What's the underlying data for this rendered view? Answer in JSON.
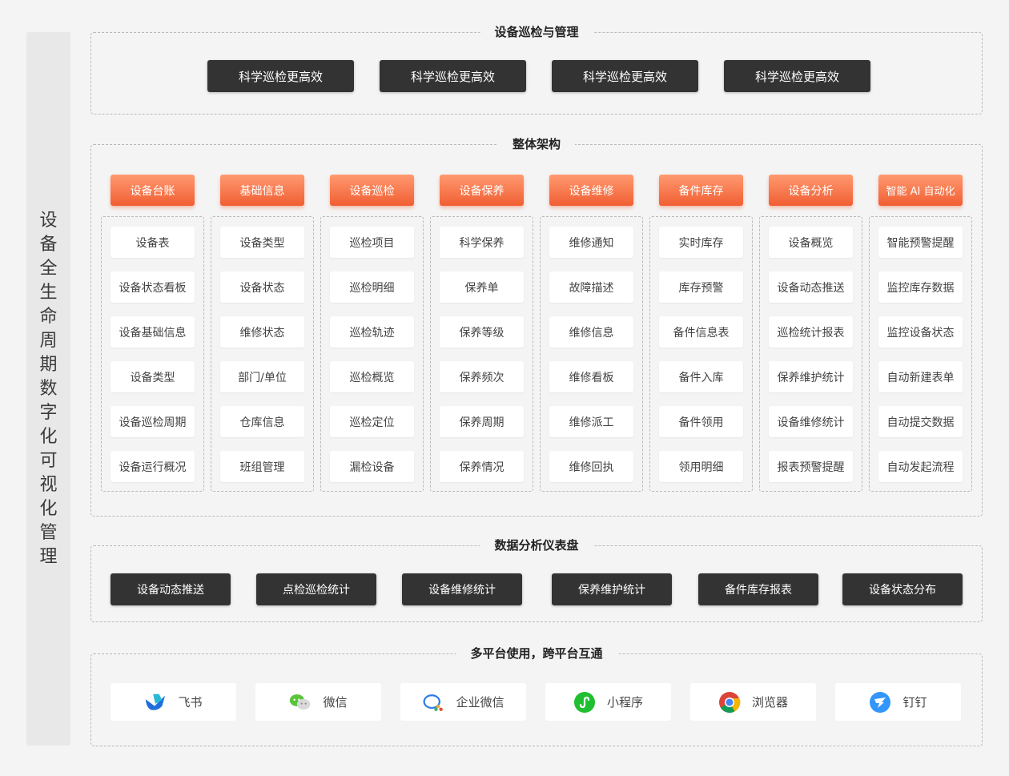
{
  "side_banner": {
    "title": "设备全生命周期数字化可视化管理"
  },
  "inspection": {
    "title": "设备巡检与管理",
    "buttons": [
      "科学巡检更高效",
      "科学巡检更高效",
      "科学巡检更高效",
      "科学巡检更高效"
    ]
  },
  "architecture": {
    "title": "整体架构",
    "columns": [
      {
        "header": "设备台账",
        "items": [
          "设备表",
          "设备状态看板",
          "设备基础信息",
          "设备类型",
          "设备巡检周期",
          "设备运行概况"
        ]
      },
      {
        "header": "基础信息",
        "items": [
          "设备类型",
          "设备状态",
          "维修状态",
          "部门/单位",
          "仓库信息",
          "班组管理"
        ]
      },
      {
        "header": "设备巡检",
        "items": [
          "巡检项目",
          "巡检明细",
          "巡检轨迹",
          "巡检概览",
          "巡检定位",
          "漏检设备"
        ]
      },
      {
        "header": "设备保养",
        "items": [
          "科学保养",
          "保养单",
          "保养等级",
          "保养频次",
          "保养周期",
          "保养情况"
        ]
      },
      {
        "header": "设备维修",
        "items": [
          "维修通知",
          "故障描述",
          "维修信息",
          "维修看板",
          "维修派工",
          "维修回执"
        ]
      },
      {
        "header": "备件库存",
        "items": [
          "实时库存",
          "库存预警",
          "备件信息表",
          "备件入库",
          "备件领用",
          "领用明细"
        ]
      },
      {
        "header": "设备分析",
        "items": [
          "设备概览",
          "设备动态推送",
          "巡检统计报表",
          "保养维护统计",
          "设备维修统计",
          "报表预警提醒"
        ]
      },
      {
        "header": "智能 AI 自动化",
        "items": [
          "智能预警提醒",
          "监控库存数据",
          "监控设备状态",
          "自动新建表单",
          "自动提交数据",
          "自动发起流程"
        ]
      }
    ]
  },
  "dashboard": {
    "title": "数据分析仪表盘",
    "buttons": [
      "设备动态推送",
      "点检巡检统计",
      "设备维修统计",
      "保养维护统计",
      "备件库存报表",
      "设备状态分布"
    ]
  },
  "platforms": {
    "title": "多平台使用，跨平台互通",
    "items": [
      {
        "label": "飞书",
        "icon": "feishu-icon"
      },
      {
        "label": "微信",
        "icon": "wechat-icon"
      },
      {
        "label": "企业微信",
        "icon": "wecom-icon"
      },
      {
        "label": "小程序",
        "icon": "miniprogram-icon"
      },
      {
        "label": "浏览器",
        "icon": "chrome-browser-icon"
      },
      {
        "label": "钉钉",
        "icon": "dingtalk-icon"
      }
    ]
  },
  "colors": {
    "accent_orange": "#f15e33",
    "dark_button": "#333333",
    "background": "#f4f4f4"
  }
}
